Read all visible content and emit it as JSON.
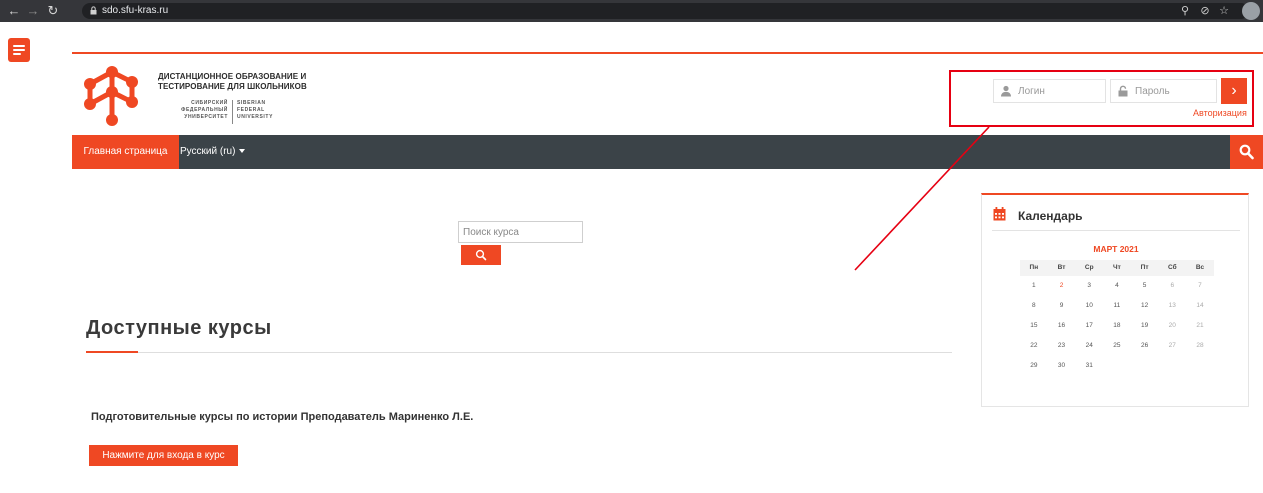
{
  "browser": {
    "url": "sdo.sfu-kras.ru",
    "back_icon": "arrow-left-icon",
    "forward_icon": "arrow-right-icon",
    "reload_icon": "reload-icon",
    "toolbar_icons": [
      "key-icon",
      "eye-off-icon",
      "star-icon",
      "profile-icon"
    ]
  },
  "header": {
    "logo_line1": "ДИСТАНЦИОННОЕ ОБРАЗОВАНИЕ И",
    "logo_line2": "ТЕСТИРОВАНИЕ ДЛЯ ШКОЛЬНИКОВ",
    "logo_sub_ru": [
      "СИБИРСКИЙ",
      "ФЕДЕРАЛЬНЫЙ",
      "УНИВЕРСИТЕТ"
    ],
    "logo_sub_en": [
      "SIBERIAN",
      "FEDERAL",
      "UNIVERSITY"
    ]
  },
  "login": {
    "username_placeholder": "Логин",
    "password_placeholder": "Пароль",
    "submit_icon": "chevron-right-icon",
    "auth_link": "Авторизация"
  },
  "navbar": {
    "home": "Главная страница",
    "language": "Русский (ru)"
  },
  "course_search": {
    "placeholder": "Поиск курса"
  },
  "courses": {
    "section_title": "Доступные курсы",
    "items": [
      {
        "title": "Подготовительные курсы по истории Преподаватель Мариненко Л.Е.",
        "button": "Нажмите для входа в курс"
      }
    ]
  },
  "calendar": {
    "title": "Календарь",
    "month": "МАРТ 2021",
    "weekdays": [
      "Пн",
      "Вт",
      "Ср",
      "Чт",
      "Пт",
      "Сб",
      "Вс"
    ],
    "weeks": [
      [
        "1",
        "2",
        "3",
        "4",
        "5",
        "6",
        "7"
      ],
      [
        "8",
        "9",
        "10",
        "11",
        "12",
        "13",
        "14"
      ],
      [
        "15",
        "16",
        "17",
        "18",
        "19",
        "20",
        "21"
      ],
      [
        "22",
        "23",
        "24",
        "25",
        "26",
        "27",
        "28"
      ],
      [
        "29",
        "30",
        "31",
        "",
        "",
        "",
        ""
      ]
    ],
    "highlighted_day": "2"
  },
  "colors": {
    "accent": "#ef4823",
    "navbar": "#3b4348",
    "annotation": "#e60012"
  }
}
